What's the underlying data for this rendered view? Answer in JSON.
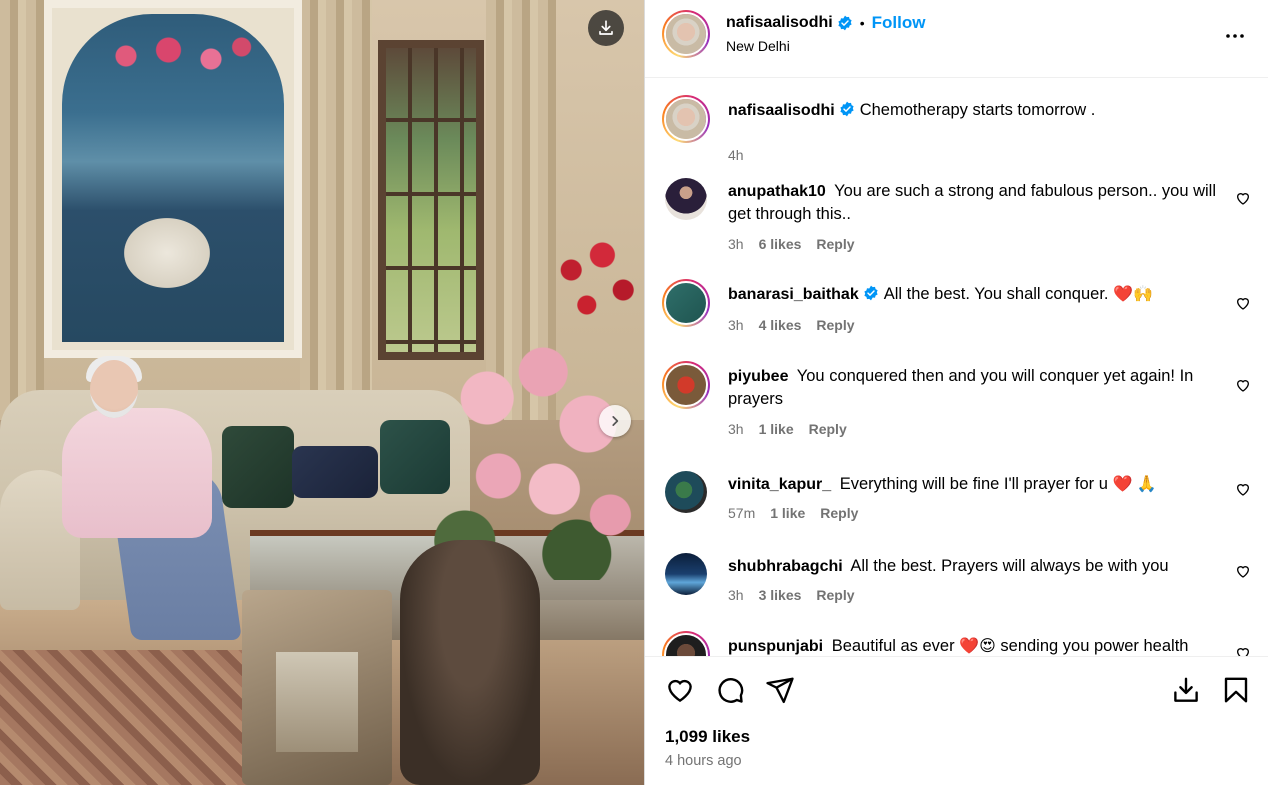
{
  "post": {
    "author": "nafisaalisodhi",
    "follow_label": "Follow",
    "dot": "•",
    "location": "New Delhi",
    "caption": "Chemotherapy starts tomorrow .",
    "caption_time": "4h",
    "likes": "1,099 likes",
    "time_ago": "4 hours ago"
  },
  "comments": [
    {
      "username": "anupathak10",
      "text": "You are such a strong and fabulous person.. you will get through this..",
      "time": "3h",
      "likes": "6 likes",
      "reply": "Reply",
      "verified": false
    },
    {
      "username": "banarasi_baithak",
      "text": "All the best. You shall conquer.",
      "emoji": "❤️🙌",
      "time": "3h",
      "likes": "4 likes",
      "reply": "Reply",
      "verified": true
    },
    {
      "username": "piyubee",
      "text": "You conquered then and you will conquer yet again! In prayers",
      "time": "3h",
      "likes": "1 like",
      "reply": "Reply",
      "verified": false
    },
    {
      "username": "vinita_kapur_",
      "text": "Everything will be fine I'll prayer for u",
      "emoji": "❤️ 🙏",
      "time": "57m",
      "likes": "1 like",
      "reply": "Reply",
      "verified": false
    },
    {
      "username": "shubhrabagchi",
      "text": "All the best. Prayers will always be with you",
      "time": "3h",
      "likes": "3 likes",
      "reply": "Reply",
      "verified": false
    },
    {
      "username": "punspunjabi",
      "text": "Beautiful as ever",
      "emoji": "❤️😍",
      "text2": "sending you power health",
      "verified": false
    }
  ],
  "icons": {
    "verified_color": "#0095f6",
    "follow_color": "#0095f6"
  }
}
